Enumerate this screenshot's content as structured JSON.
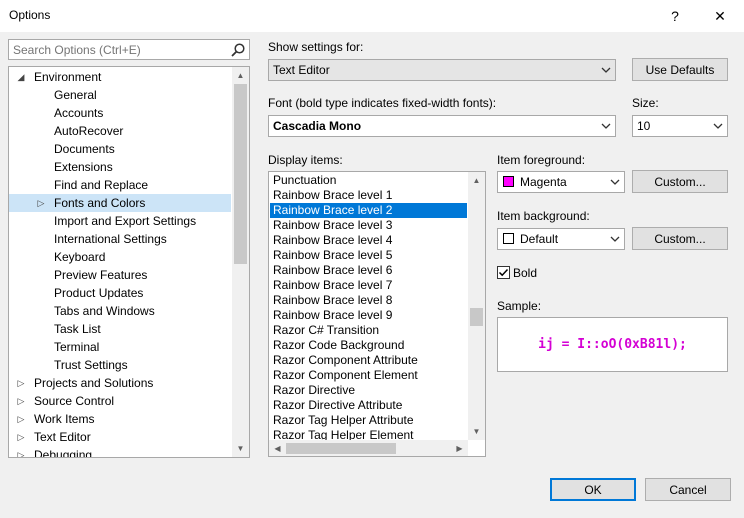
{
  "window": {
    "title": "Options",
    "help_glyph": "?",
    "close_glyph": "✕"
  },
  "search": {
    "placeholder": "Search Options (Ctrl+E)"
  },
  "tree": {
    "items": [
      {
        "label": "Environment",
        "level": 0,
        "expander": "expanded",
        "selected": false
      },
      {
        "label": "General",
        "level": 1,
        "expander": "none",
        "selected": false
      },
      {
        "label": "Accounts",
        "level": 1,
        "expander": "none",
        "selected": false
      },
      {
        "label": "AutoRecover",
        "level": 1,
        "expander": "none",
        "selected": false
      },
      {
        "label": "Documents",
        "level": 1,
        "expander": "none",
        "selected": false
      },
      {
        "label": "Extensions",
        "level": 1,
        "expander": "none",
        "selected": false
      },
      {
        "label": "Find and Replace",
        "level": 1,
        "expander": "none",
        "selected": false
      },
      {
        "label": "Fonts and Colors",
        "level": 1,
        "expander": "collapsed",
        "selected": true
      },
      {
        "label": "Import and Export Settings",
        "level": 1,
        "expander": "none",
        "selected": false
      },
      {
        "label": "International Settings",
        "level": 1,
        "expander": "none",
        "selected": false
      },
      {
        "label": "Keyboard",
        "level": 1,
        "expander": "none",
        "selected": false
      },
      {
        "label": "Preview Features",
        "level": 1,
        "expander": "none",
        "selected": false
      },
      {
        "label": "Product Updates",
        "level": 1,
        "expander": "none",
        "selected": false
      },
      {
        "label": "Tabs and Windows",
        "level": 1,
        "expander": "none",
        "selected": false
      },
      {
        "label": "Task List",
        "level": 1,
        "expander": "none",
        "selected": false
      },
      {
        "label": "Terminal",
        "level": 1,
        "expander": "none",
        "selected": false
      },
      {
        "label": "Trust Settings",
        "level": 1,
        "expander": "none",
        "selected": false
      },
      {
        "label": "Projects and Solutions",
        "level": 0,
        "expander": "collapsed",
        "selected": false
      },
      {
        "label": "Source Control",
        "level": 0,
        "expander": "collapsed",
        "selected": false
      },
      {
        "label": "Work Items",
        "level": 0,
        "expander": "collapsed",
        "selected": false
      },
      {
        "label": "Text Editor",
        "level": 0,
        "expander": "collapsed",
        "selected": false
      },
      {
        "label": "Debugging",
        "level": 0,
        "expander": "collapsed",
        "selected": false
      }
    ]
  },
  "settings_for": {
    "label": "Show settings for:",
    "value": "Text Editor",
    "use_defaults": "Use Defaults"
  },
  "font": {
    "label": "Font (bold type indicates fixed-width fonts):",
    "value": "Cascadia Mono"
  },
  "size": {
    "label": "Size:",
    "value": "10"
  },
  "display_items": {
    "label": "Display items:",
    "items": [
      "Punctuation",
      "Rainbow Brace level 1",
      "Rainbow Brace level 2",
      "Rainbow Brace level 3",
      "Rainbow Brace level 4",
      "Rainbow Brace level 5",
      "Rainbow Brace level 6",
      "Rainbow Brace level 7",
      "Rainbow Brace level 8",
      "Rainbow Brace level 9",
      "Razor C# Transition",
      "Razor Code Background",
      "Razor Component Attribute",
      "Razor Component Element",
      "Razor Directive",
      "Razor Directive Attribute",
      "Razor Tag Helper Attribute",
      "Razor Tag Helper Element"
    ],
    "selected_index": 2
  },
  "foreground": {
    "label": "Item foreground:",
    "value": "Magenta",
    "swatch_color": "#ff00ff",
    "custom": "Custom..."
  },
  "background": {
    "label": "Item background:",
    "value": "Default",
    "swatch_color": "#ffffff",
    "custom": "Custom..."
  },
  "bold": {
    "label": "Bold",
    "checked": true
  },
  "sample": {
    "label": "Sample:",
    "text": "ij = I::oO(0xB81l);",
    "color": "#d400d4"
  },
  "footer": {
    "ok": "OK",
    "cancel": "Cancel"
  },
  "colors": {
    "selection": "#0078d7",
    "tree_selection": "#cce4f7"
  }
}
